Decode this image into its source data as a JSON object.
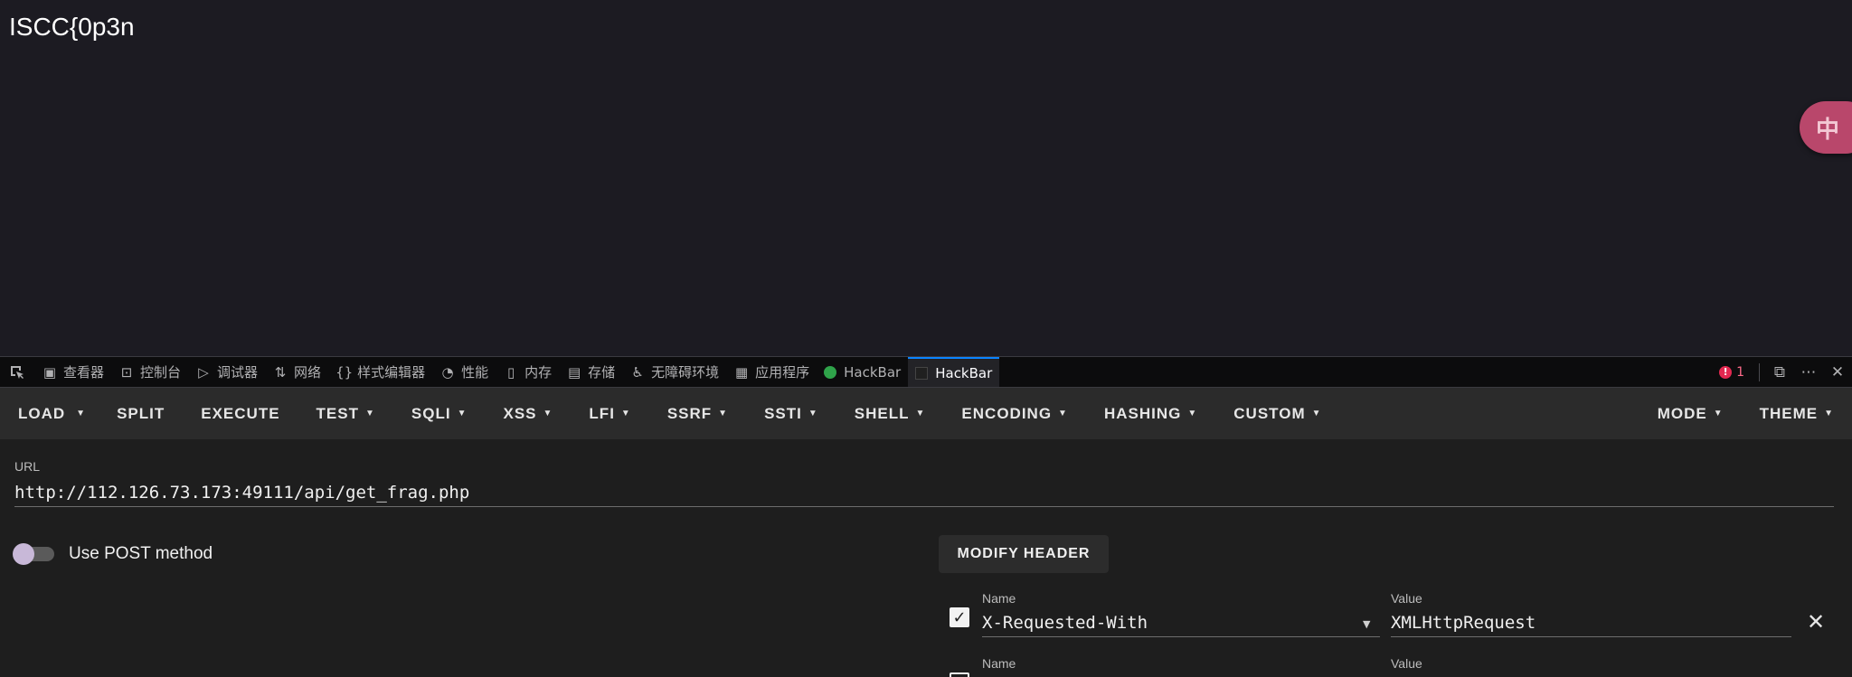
{
  "page": {
    "text": "ISCC{0p3n",
    "translate_icon": "translate-icon"
  },
  "devtools": {
    "tabs": [
      {
        "label": "查看器",
        "icon": "inspector-icon"
      },
      {
        "label": "控制台",
        "icon": "console-icon"
      },
      {
        "label": "调试器",
        "icon": "debugger-icon"
      },
      {
        "label": "网络",
        "icon": "network-icon"
      },
      {
        "label": "样式编辑器",
        "icon": "style-editor-icon"
      },
      {
        "label": "性能",
        "icon": "performance-icon"
      },
      {
        "label": "内存",
        "icon": "memory-icon"
      },
      {
        "label": "存储",
        "icon": "storage-icon"
      },
      {
        "label": "无障碍环境",
        "icon": "accessibility-icon"
      },
      {
        "label": "应用程序",
        "icon": "application-icon"
      },
      {
        "label": "HackBar",
        "icon": "hackbar-green-icon"
      },
      {
        "label": "HackBar",
        "icon": "hackbar-dark-icon",
        "active": true
      }
    ],
    "error_count": "1"
  },
  "hackbar": {
    "menu": {
      "load": "LOAD",
      "split": "SPLIT",
      "execute": "EXECUTE",
      "test": "TEST",
      "sqli": "SQLI",
      "xss": "XSS",
      "lfi": "LFI",
      "ssrf": "SSRF",
      "ssti": "SSTI",
      "shell": "SHELL",
      "encoding": "ENCODING",
      "hashing": "HASHING",
      "custom": "CUSTOM",
      "mode": "MODE",
      "theme": "THEME"
    },
    "url_label": "URL",
    "url_value": "http://112.126.73.173:49111/api/get_frag.php",
    "post_label": "Use POST method",
    "post_enabled": false,
    "modify_header_label": "MODIFY HEADER",
    "headers": [
      {
        "name_label": "Name",
        "name": "X-Requested-With",
        "value_label": "Value",
        "value": "XMLHttpRequest",
        "checked": true
      },
      {
        "name_label": "Name",
        "name": "",
        "value_label": "Value",
        "value": "",
        "checked": false
      }
    ]
  }
}
